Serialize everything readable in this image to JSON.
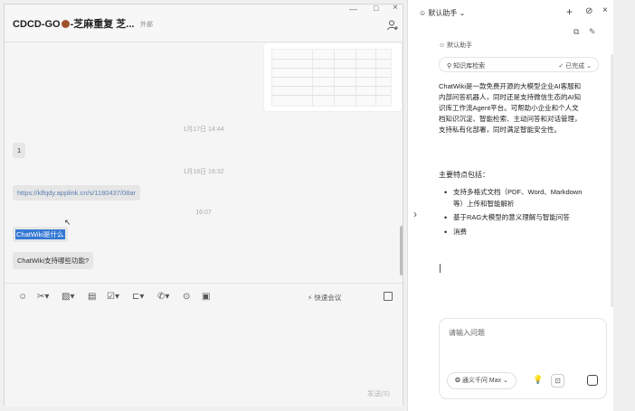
{
  "chat": {
    "title_part1": "CDCD-GO",
    "title_part2": "-芝麻重复 芝...",
    "subtitle": "外部",
    "window_controls": {
      "minimize": "—",
      "maximize": "□",
      "close": "×"
    },
    "messages": [
      {
        "type": "timestamp",
        "text": "1月17日 14:44"
      },
      {
        "type": "text",
        "text": "1"
      },
      {
        "type": "timestamp",
        "text": "1月18日 16:32"
      },
      {
        "type": "link",
        "text": "https://klfqdy.applink.cn/s/1180437/08ar"
      },
      {
        "type": "timestamp",
        "text": "16:07"
      },
      {
        "type": "selected",
        "text": "ChatWiki是什么"
      },
      {
        "type": "text",
        "text": "ChatWiki支持哪些功能?"
      }
    ],
    "toolbar": {
      "icons": [
        "emoji-icon",
        "scissors-icon",
        "image-icon",
        "doc-icon",
        "checkbox-icon",
        "folder-icon",
        "phone-icon",
        "chat-icon",
        "calendar-icon"
      ],
      "quick_meeting": "快速会议",
      "send_label": "发送(S)"
    }
  },
  "assistant": {
    "title": "默认助手",
    "bot_name": "默认助手",
    "kb_label": "知识库检索",
    "kb_status": "已完成",
    "answer": "ChatWiki是一款免费开源的大模型企业AI客服和内部问答机器人，同时还是支持微信生态的AI知识库工作流Agent平台。可帮助小企业和个人文档知识沉淀、智能检索、主动问答和对话管理，支持私有化部署，同时满足智能安全性。",
    "features_heading": "主要特点包括：",
    "features": [
      "支持多格式文档（PDF、Word、Markdown等）上传和智能解析",
      "基于RAG大模型的意义理解与智能问答",
      "消费"
    ],
    "input_placeholder": "请输入问题",
    "model_label": "通义千问 Max"
  }
}
